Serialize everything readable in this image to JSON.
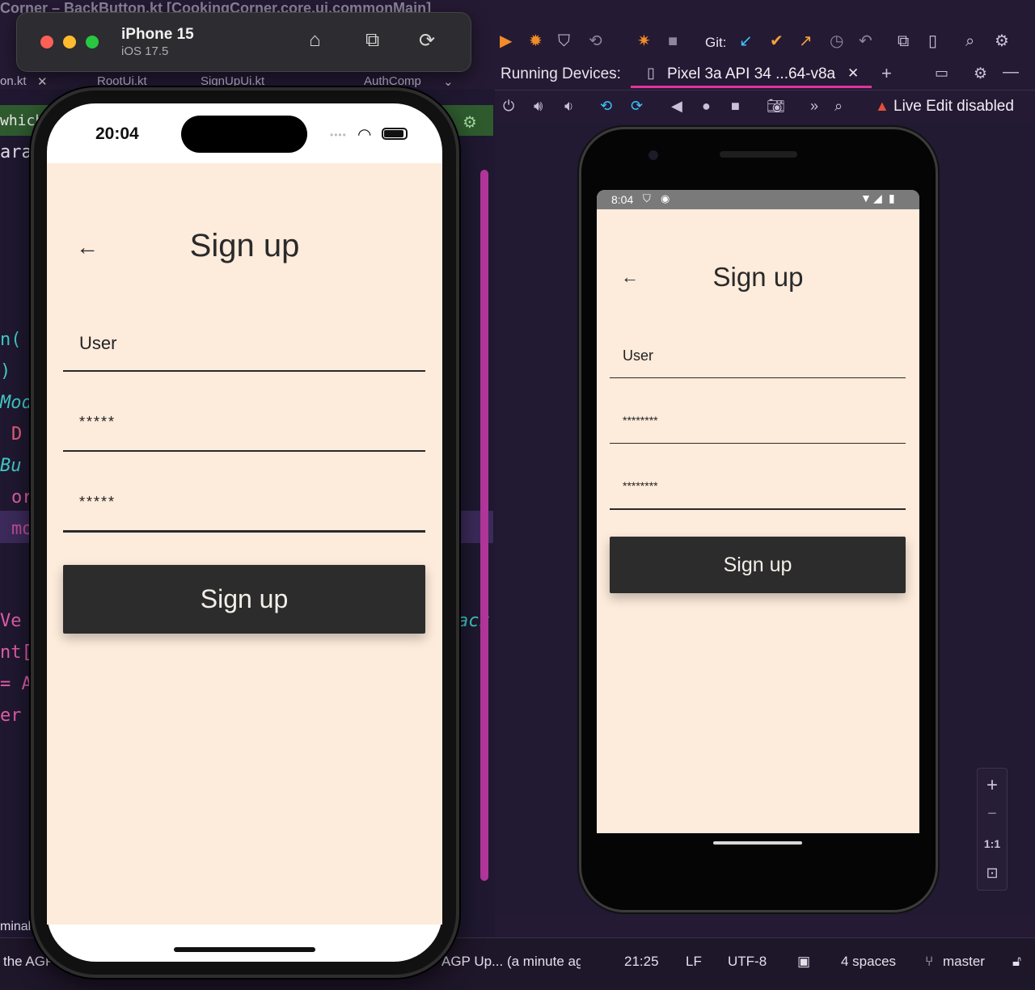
{
  "ide": {
    "window_title": "Corner – BackButton.kt [CookingCorner.core.ui.commonMain]",
    "editor_tabs": [
      "on.kt",
      "RootUi.kt",
      "SignUpUi.kt",
      "AuthComp"
    ],
    "code_fragments": [
      "which",
      "ara",
      "n(",
      ")",
      "Mod",
      "D",
      "Bu",
      "or",
      "mo",
      "Ve",
      "nt[",
      "= A",
      "er",
      "ack"
    ],
    "git_label": "Git:",
    "running_devices_label": "Running Devices:",
    "device_tab": "Pixel 3a API 34 ...64-v8a",
    "live_edit": "Live Edit disabled",
    "zoom": {
      "plus": "+",
      "minus": "−",
      "one_to_one": "1:1"
    },
    "status": {
      "left_terminal": "minal",
      "left_agp": "the AGP",
      "agp_update": "AGP Up... (a minute ago",
      "position": "21:25",
      "line_sep": "LF",
      "encoding": "UTF-8",
      "indent": "4 spaces",
      "branch": "master"
    },
    "colors": {
      "accent": "#e0359f",
      "run": "#f28c28",
      "bg": "#241a33"
    }
  },
  "simulator": {
    "name": "iPhone 15",
    "os": "iOS 17.5",
    "icons": [
      "home-icon",
      "screenshot-icon",
      "rotate-icon"
    ]
  },
  "ios_app": {
    "status_time": "20:04",
    "title": "Sign up",
    "back_icon": "arrow-left-icon",
    "username_value": "User",
    "password_value": "*****",
    "confirm_password_value": "*****",
    "button_label": "Sign up",
    "colors": {
      "background": "#fdebdb",
      "button": "#2c2c2c"
    }
  },
  "android_app": {
    "status_time": "8:04",
    "title": "Sign up",
    "back_icon": "arrow-left-icon",
    "username_value": "User",
    "password_value": "********",
    "confirm_password_value": "********",
    "button_label": "Sign up"
  }
}
